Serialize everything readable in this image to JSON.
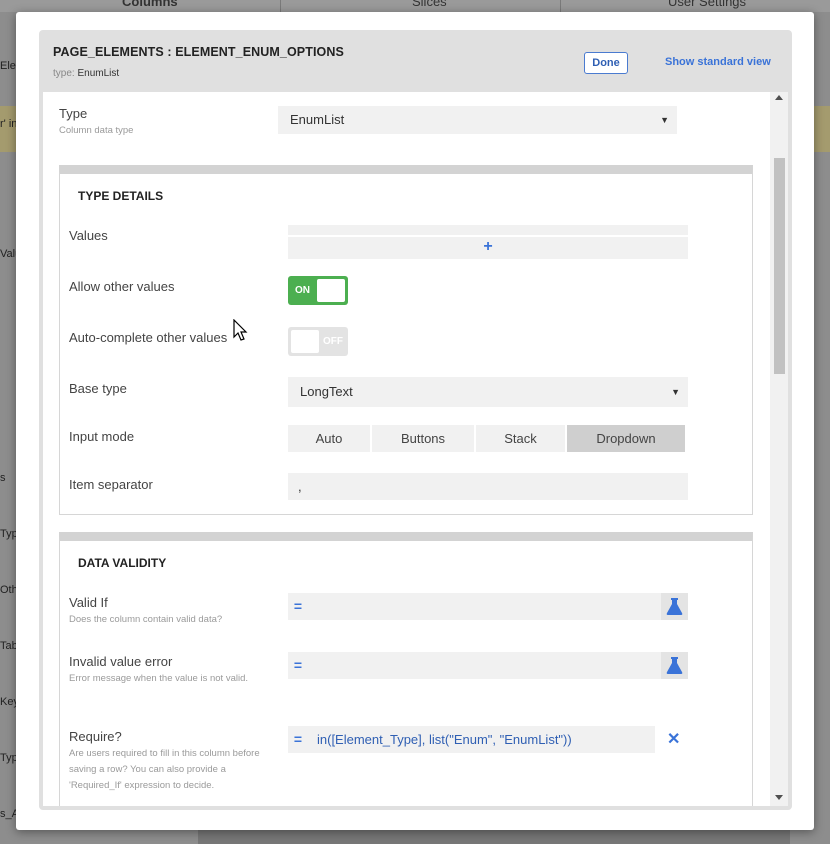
{
  "background": {
    "tabs": [
      "Columns",
      "Slices",
      "User Settings"
    ],
    "left_fragments": [
      "Ele",
      "r' in",
      "Valu",
      "s",
      "Typ",
      "Oth",
      "Tab",
      "Key",
      "Typ",
      "s_A"
    ]
  },
  "modal": {
    "title": "PAGE_ELEMENTS : ELEMENT_ENUM_OPTIONS",
    "type_prefix": "type:",
    "type_value": "EnumList",
    "done_label": "Done",
    "standard_view_label": "Show standard view"
  },
  "type_field": {
    "label": "Type",
    "sublabel": "Column data type",
    "value": "EnumList"
  },
  "type_details": {
    "title": "TYPE DETAILS",
    "values_label": "Values",
    "values_add": "+",
    "allow_other_label": "Allow other values",
    "allow_other_state": "ON",
    "autocomplete_label": "Auto-complete other values",
    "autocomplete_state": "OFF",
    "base_type_label": "Base type",
    "base_type_value": "LongText",
    "input_mode_label": "Input mode",
    "input_mode_options": [
      "Auto",
      "Buttons",
      "Stack",
      "Dropdown"
    ],
    "input_mode_selected": "Dropdown",
    "separator_label": "Item separator",
    "separator_value": ","
  },
  "data_validity": {
    "title": "DATA VALIDITY",
    "valid_if_label": "Valid If",
    "valid_if_sublabel": "Does the column contain valid data?",
    "valid_if_value": "",
    "invalid_error_label": "Invalid value error",
    "invalid_error_sublabel": "Error message when the value is not valid.",
    "invalid_error_value": "",
    "require_label": "Require?",
    "require_sublabel": "Are users required to fill in this column before saving a row? You can also provide a 'Required_If' expression to decide.",
    "require_value": "in([Element_Type], list(\"Enum\", \"EnumList\"))",
    "eq_symbol": "=",
    "clear_symbol": "✕"
  },
  "colors": {
    "accent": "#3a73d8",
    "toggle_on": "#4caf50",
    "selected_option": "#cfcfcf"
  }
}
